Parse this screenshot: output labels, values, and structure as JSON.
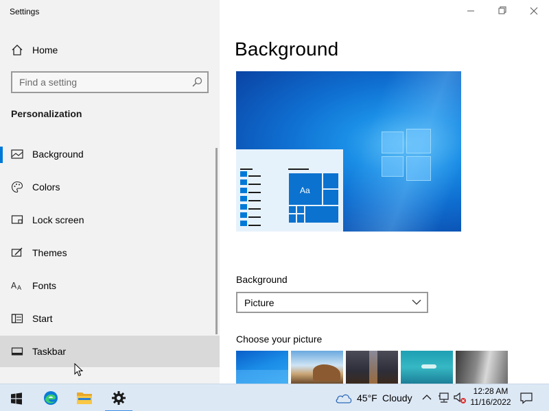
{
  "window": {
    "title": "Settings"
  },
  "sidebar": {
    "home_label": "Home",
    "search_placeholder": "Find a setting",
    "section_title": "Personalization",
    "items": [
      {
        "label": "Background",
        "icon": "picture-icon"
      },
      {
        "label": "Colors",
        "icon": "palette-icon"
      },
      {
        "label": "Lock screen",
        "icon": "lock-screen-icon"
      },
      {
        "label": "Themes",
        "icon": "themes-icon"
      },
      {
        "label": "Fonts",
        "icon": "fonts-icon"
      },
      {
        "label": "Start",
        "icon": "start-icon"
      },
      {
        "label": "Taskbar",
        "icon": "taskbar-icon"
      }
    ],
    "selected": "Background",
    "hovered": "Taskbar"
  },
  "main": {
    "title": "Background",
    "preview": {
      "tile_text": "Aa"
    },
    "background_label": "Background",
    "background_value": "Picture",
    "choose_label": "Choose your picture"
  },
  "taskbar": {
    "weather_temp": "45°F",
    "weather_condition": "Cloudy",
    "time": "12:28 AM",
    "date": "11/16/2022"
  },
  "colors": {
    "accent": "#0078d7",
    "sidebar_bg": "#f2f2f2",
    "taskbar_bg": "#dde8f5"
  }
}
